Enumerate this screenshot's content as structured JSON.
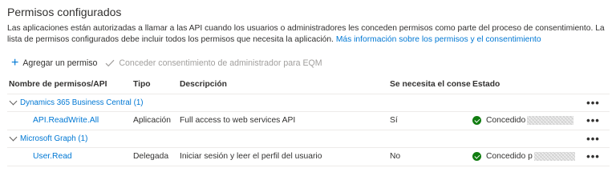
{
  "page": {
    "title": "Permisos configurados",
    "description": "Las aplicaciones están autorizadas a llamar a las API cuando los usuarios o administradores les conceden permisos como parte del proceso de consentimiento. La lista de permisos configurados debe incluir todos los permisos que necesita la aplicación.",
    "link": "Más información sobre los permisos y el consentimiento"
  },
  "toolbar": {
    "add_label": "Agregar un permiso",
    "add_icon": "plus-icon",
    "grant_label": "Conceder consentimiento de administrador para EQM",
    "grant_icon": "check-icon"
  },
  "table": {
    "headers": [
      "Nombre de permisos/API",
      "Tipo",
      "Descripción",
      "Se necesita el conse...",
      "Estado"
    ],
    "more_glyph": "•••",
    "groups": [
      {
        "name": "Dynamics 365 Business Central (1)",
        "permissions": [
          {
            "name": "API.ReadWrite.All",
            "type": "Aplicación",
            "description": "Full access to web services API",
            "consent": "Sí",
            "status": "Concedido"
          }
        ]
      },
      {
        "name": "Microsoft Graph (1)",
        "permissions": [
          {
            "name": "User.Read",
            "type": "Delegada",
            "description": "Iniciar sesión y leer el perfil del usuario",
            "consent": "No",
            "status": "Concedido p"
          }
        ]
      }
    ]
  },
  "colors": {
    "link": "#0078d4",
    "success": "#107c10",
    "disabled": "#a19f9d"
  }
}
